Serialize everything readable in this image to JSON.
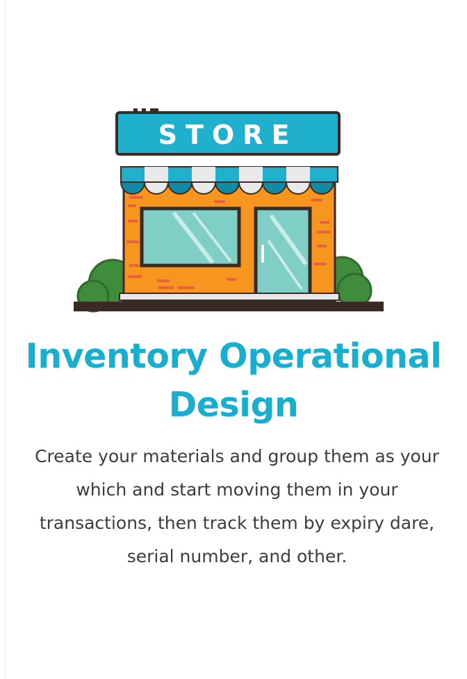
{
  "illustration": {
    "sign_text": "STORE",
    "colors": {
      "teal": "#1fb0ce",
      "orange": "#f7961e",
      "glass": "#7fcfc6",
      "bush": "#3f8c3d",
      "outline": "#3a2a26"
    }
  },
  "title": {
    "line1": "Inventory Operational",
    "line2": "Design",
    "color": "#17aed0"
  },
  "description": {
    "lines": [
      "Create your materials and group them as your",
      "which and start moving them in your",
      "transactions, then track them by expiry dare,",
      "serial number, and other."
    ]
  }
}
